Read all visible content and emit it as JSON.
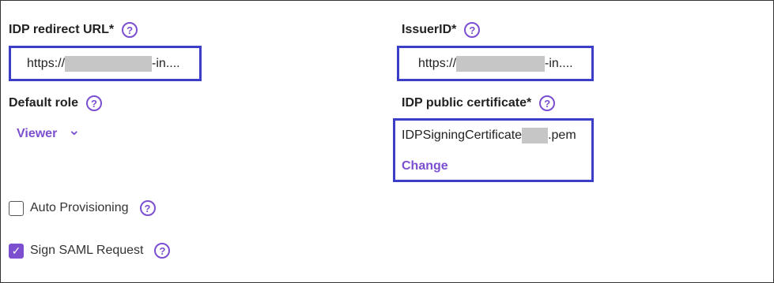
{
  "idp_redirect": {
    "label": "IDP redirect URL*",
    "help": "?",
    "value_prefix": "https://",
    "value_suffix": "-in...."
  },
  "issuer": {
    "label": "IssuerID*",
    "help": "?",
    "value_prefix": "https://",
    "value_suffix": "-in...."
  },
  "default_role": {
    "label": "Default role",
    "help": "?",
    "selected": "Viewer",
    "chevron": "⌄"
  },
  "certificate": {
    "label": "IDP public certificate*",
    "help": "?",
    "file_prefix": "IDPSigningCertificate",
    "file_suffix": ".pem",
    "change_label": "Change"
  },
  "auto_provisioning": {
    "label": "Auto Provisioning",
    "help": "?",
    "checked": false
  },
  "sign_saml": {
    "label": "Sign SAML Request",
    "help": "?",
    "checked": true,
    "check_glyph": "✓"
  },
  "colors": {
    "accent": "#7b4fd0",
    "highlight_box": "#3b3ec6",
    "mask": "#c6c6c6"
  }
}
